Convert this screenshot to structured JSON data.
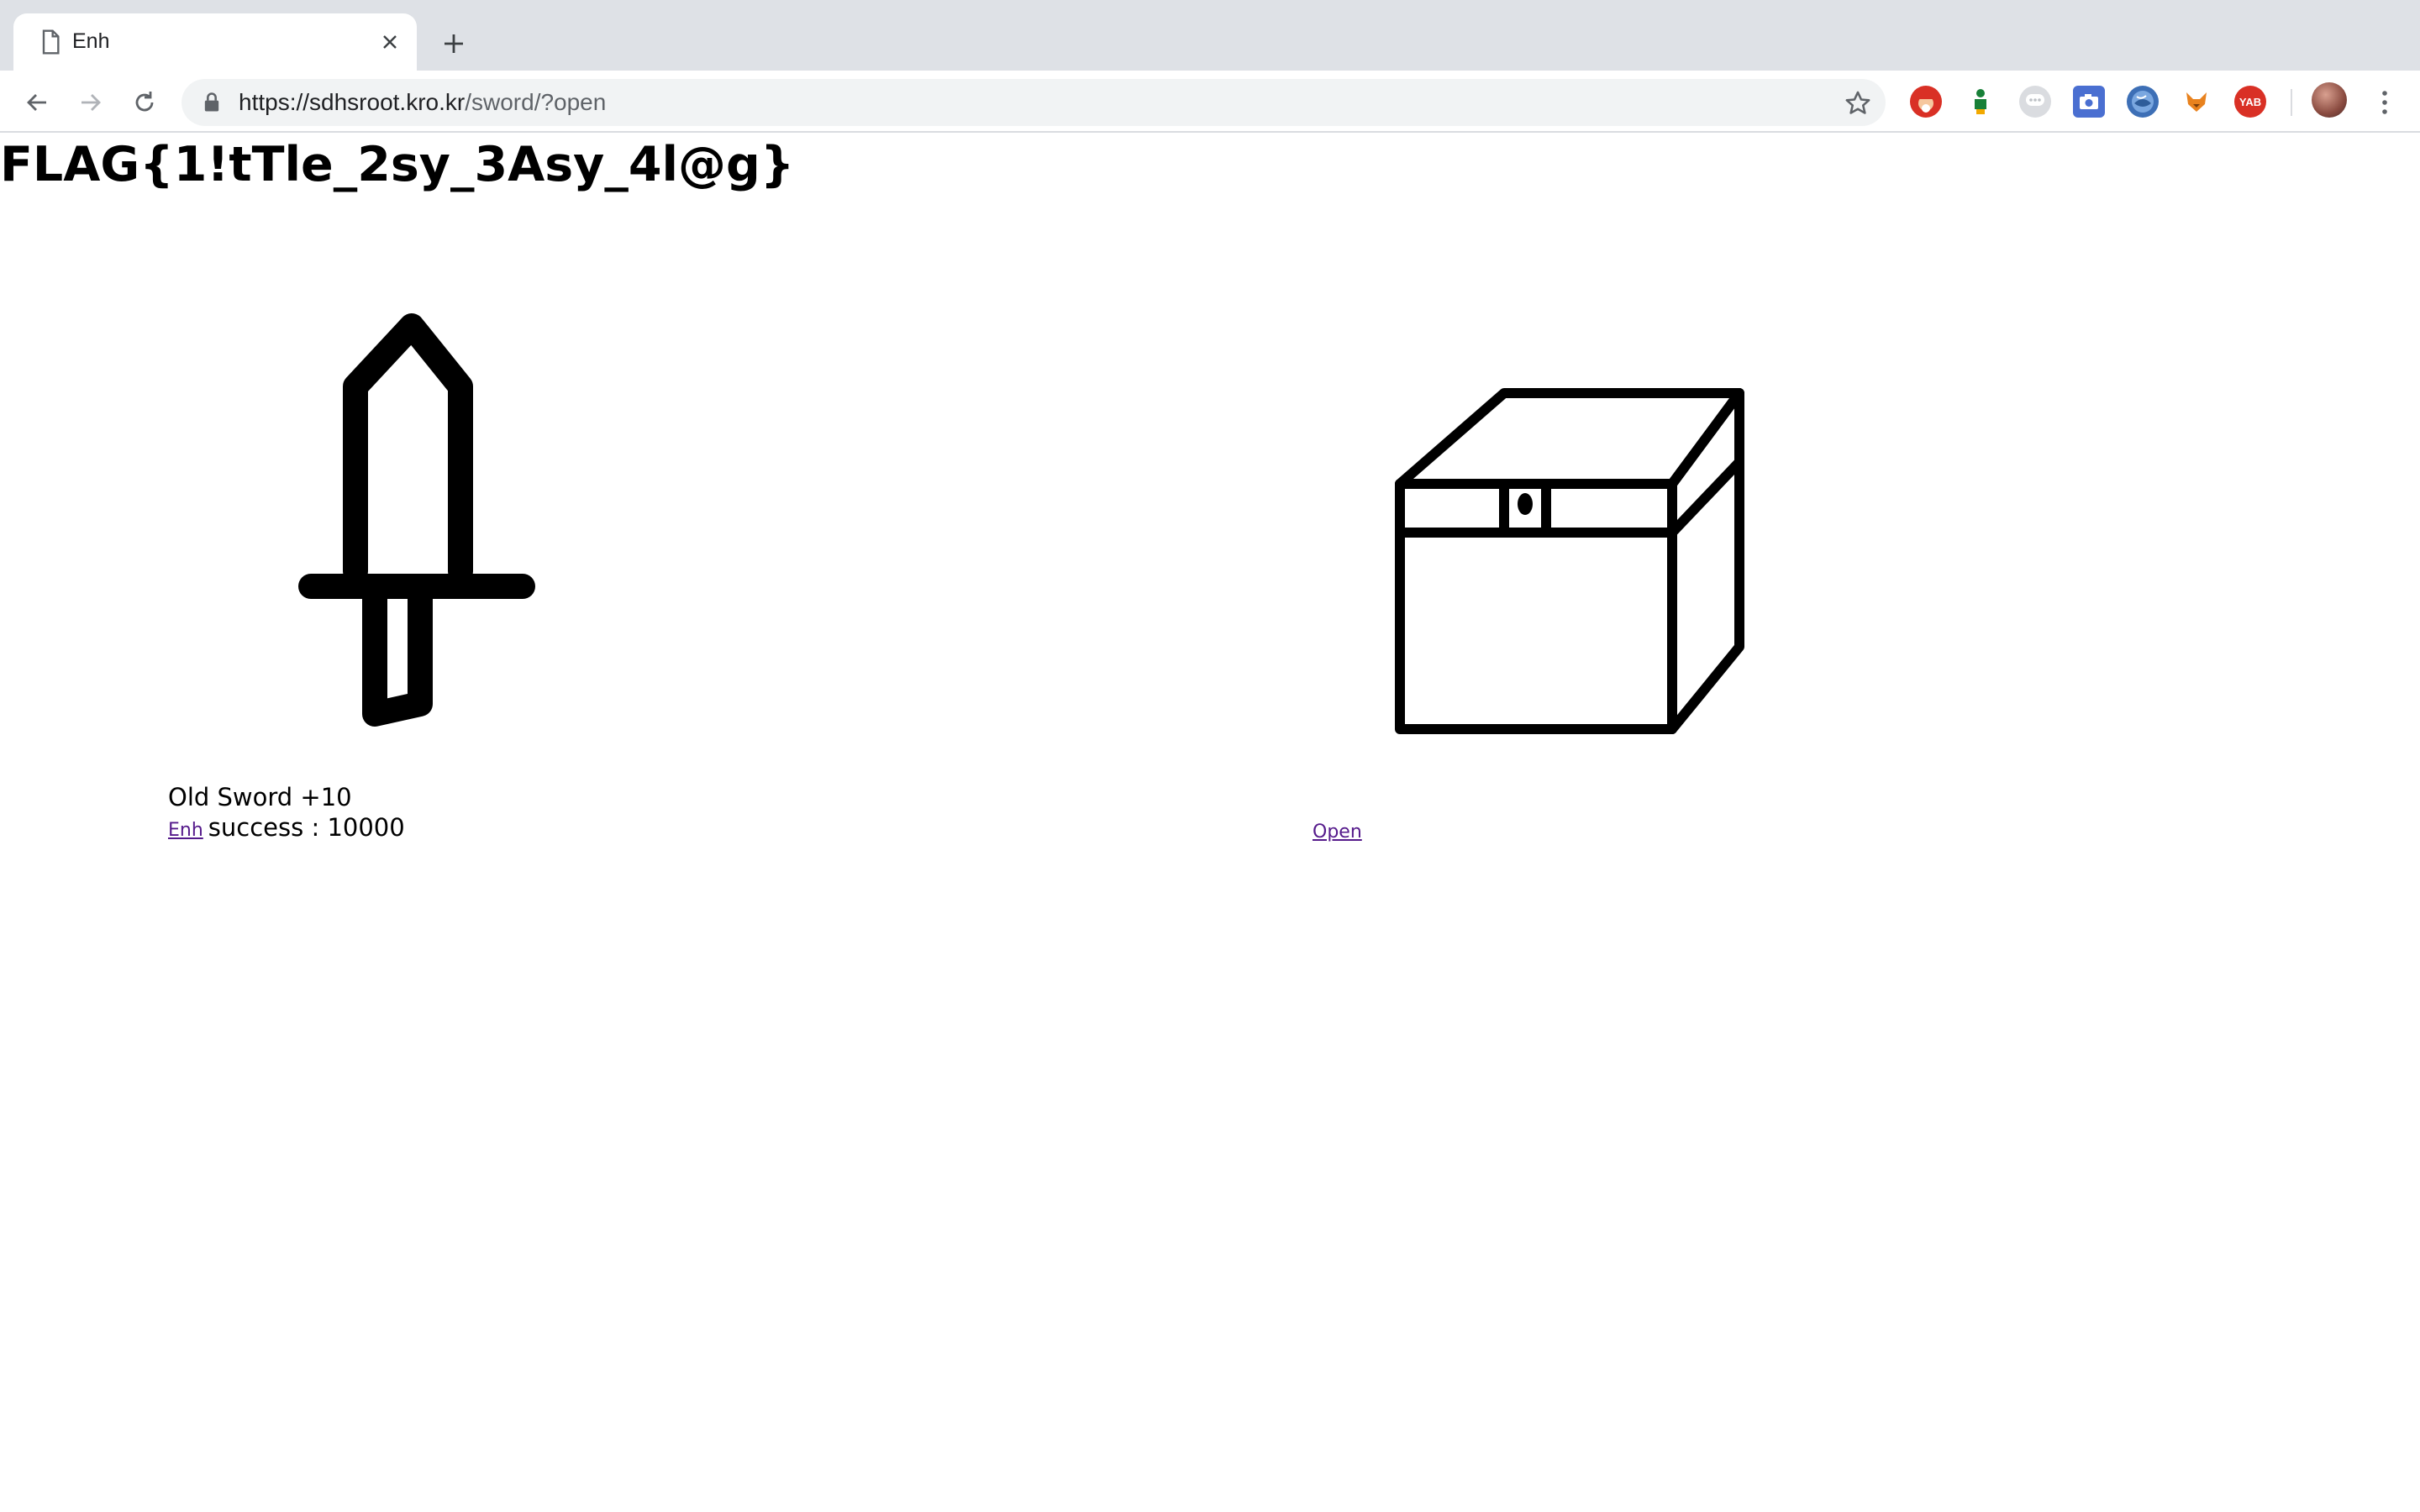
{
  "browser": {
    "tab": {
      "title": "Enh"
    },
    "address_bar": {
      "url_host": "https://sdhsroot.kro.kr",
      "url_path": "/sword/?open"
    },
    "extensions": [
      {
        "name": "santa-extension-icon",
        "color": "#d93025"
      },
      {
        "name": "green-figure-extension-icon",
        "color": "#188038"
      },
      {
        "name": "chat-bubble-extension-icon",
        "color": "#bdc1c6"
      },
      {
        "name": "camera-extension-icon",
        "color": "#4a6fd1"
      },
      {
        "name": "globe-extension-icon",
        "color": "#3d6fb6"
      },
      {
        "name": "fox-extension-icon",
        "color": "#e8821e"
      },
      {
        "name": "yab-extension-icon",
        "color": "#d93025",
        "label": "YAB"
      }
    ]
  },
  "page": {
    "flag": "FLAG{1!tTle_2sy_3Asy_4l@g}",
    "item": {
      "name": "Old Sword +10",
      "enh_label": "Enh",
      "success_text": "success : 10000"
    },
    "chest": {
      "open_label": "Open"
    }
  }
}
